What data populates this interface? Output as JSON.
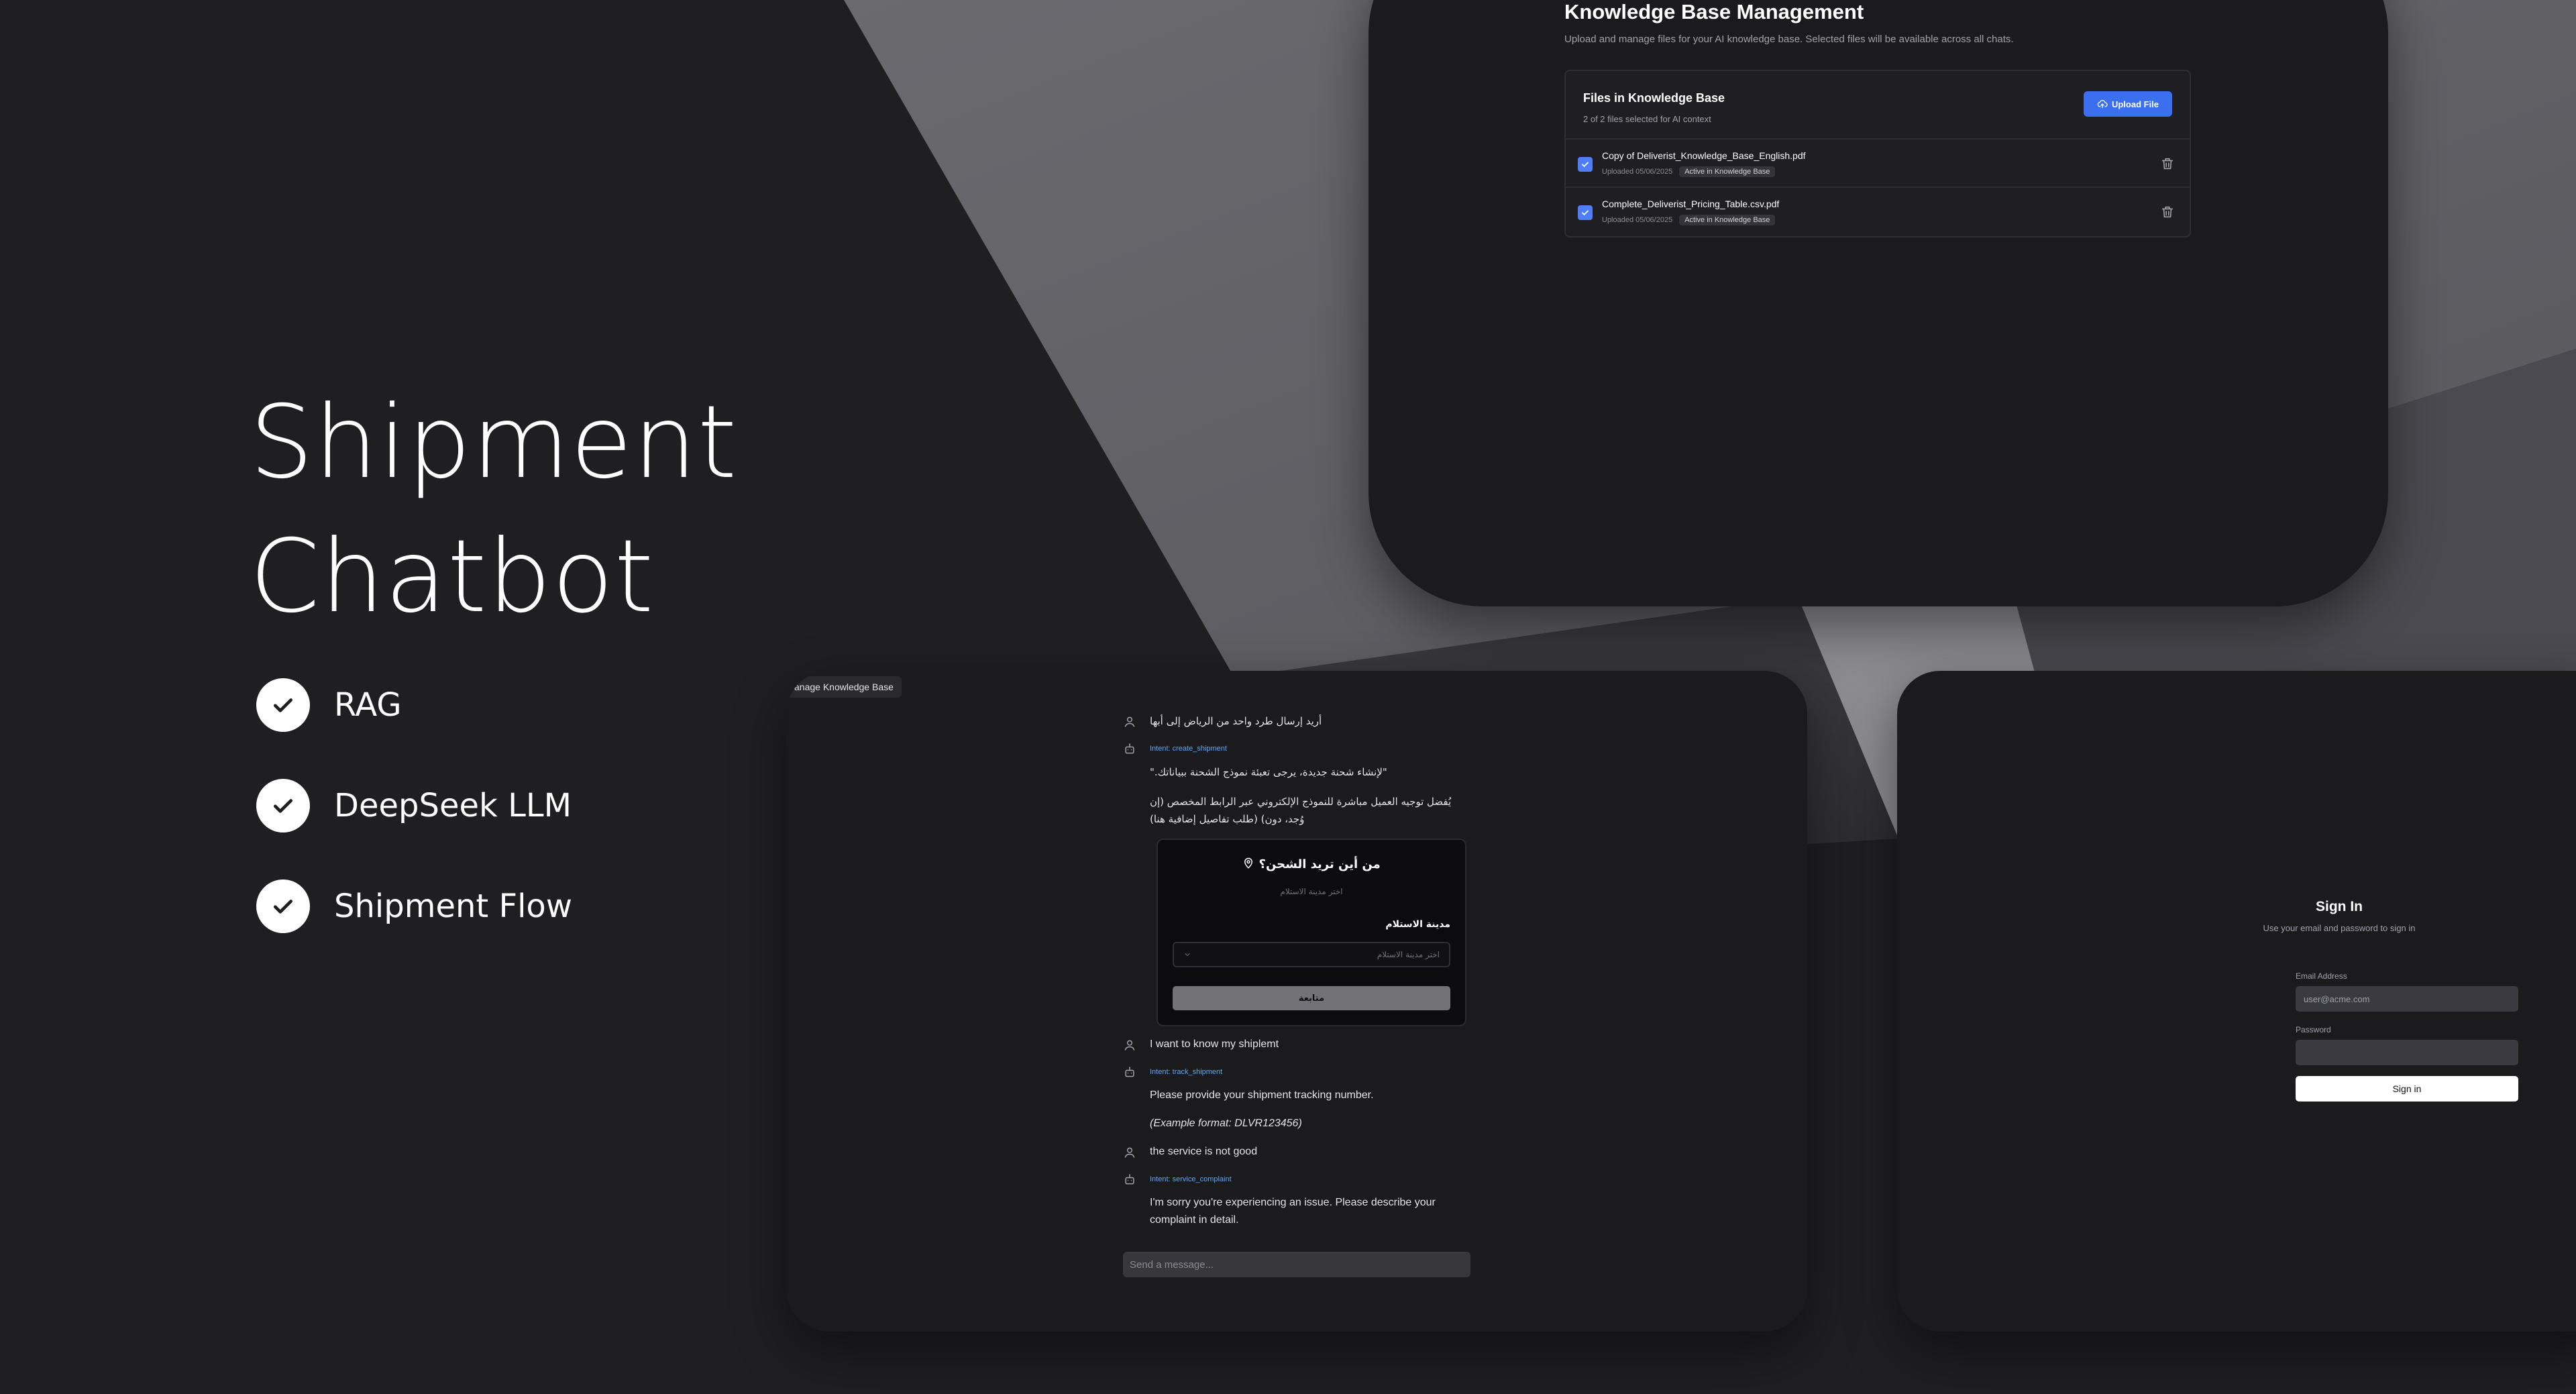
{
  "hero": {
    "title_line1": "Shipment",
    "title_line2": "Chatbot",
    "features": [
      "RAG",
      "DeepSeek LLM",
      "Shipment Flow"
    ]
  },
  "knowledge_base": {
    "title": "Knowledge Base Management",
    "subtitle": "Upload and manage files for your AI knowledge base. Selected files will be available across all chats.",
    "card_title": "Files in Knowledge Base",
    "card_subtitle": "2 of 2 files selected for AI context",
    "upload_label": "Upload File",
    "files": [
      {
        "name": "Copy of Deliverist_Knowledge_Base_English.pdf",
        "uploaded": "Uploaded 05/06/2025",
        "status": "Active in Knowledge Base",
        "checked": true
      },
      {
        "name": "Complete_Deliverist_Pricing_Table.csv.pdf",
        "uploaded": "Uploaded 05/06/2025",
        "status": "Active in Knowledge Base",
        "checked": true
      }
    ]
  },
  "chat": {
    "tab_label": "anage Knowledge Base",
    "messages": [
      {
        "role": "user",
        "text": "أريد إرسال طرد واحد من الرياض إلى أبها"
      },
      {
        "role": "bot",
        "intent": "Intent: create_shipment",
        "text1": "\"لإنشاء شحنة جديدة، يرجى تعبئة نموذج الشحنة ببياناتك.\"",
        "text2": "يُفضل توجيه العميل مباشرة للنموذج الإلكتروني عبر الرابط المخصص (إن وُجد، دون) (طلب تفاصيل إضافية هنا)"
      },
      {
        "role": "user",
        "text": "I want to know my shiplemt"
      },
      {
        "role": "bot",
        "intent": "Intent: track_shipment",
        "text1": "Please provide your shipment tracking number.",
        "text2": "(Example format: DLVR123456)"
      },
      {
        "role": "user",
        "text": "the service is not good"
      },
      {
        "role": "bot",
        "intent": "Intent: service_complaint",
        "text1": "I'm sorry you're experiencing an issue. Please describe your complaint in detail."
      }
    ],
    "shipment_form": {
      "question": "من أين تريد الشحن؟",
      "question_sub": "اختر مدينة الاستلام",
      "field_label": "مدينة الاستلام",
      "select_placeholder": "اختر مدينة الاستلام",
      "button_label": "متابعة"
    },
    "input_placeholder": "Send a message..."
  },
  "sign_in": {
    "title": "Sign In",
    "subtitle": "Use your email and password to sign in",
    "email_label": "Email Address",
    "email_placeholder": "user@acme.com",
    "password_label": "Password",
    "button_label": "Sign in"
  },
  "colors": {
    "accent": "#3b6ff0",
    "intent": "#60a5fa",
    "background": "#1e1e21",
    "frame": "#1b1b1e"
  }
}
